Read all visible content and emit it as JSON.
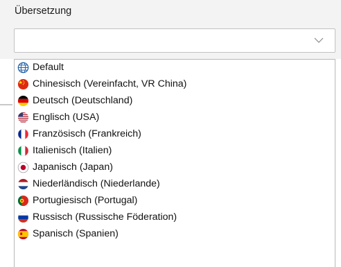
{
  "translation": {
    "label": "Übersetzung",
    "selected_value": "",
    "chevron_icon": "chevron-down-icon",
    "options": [
      {
        "label": "Default",
        "icon": "globe-icon"
      },
      {
        "label": "Chinesisch (Vereinfacht, VR China)",
        "icon": "flag-china-icon"
      },
      {
        "label": "Deutsch (Deutschland)",
        "icon": "flag-germany-icon"
      },
      {
        "label": "Englisch (USA)",
        "icon": "flag-usa-icon"
      },
      {
        "label": "Französisch (Frankreich)",
        "icon": "flag-france-icon"
      },
      {
        "label": "Italienisch (Italien)",
        "icon": "flag-italy-icon"
      },
      {
        "label": "Japanisch (Japan)",
        "icon": "flag-japan-icon"
      },
      {
        "label": "Niederländisch (Niederlande)",
        "icon": "flag-netherlands-icon"
      },
      {
        "label": "Portugiesisch (Portugal)",
        "icon": "flag-portugal-icon"
      },
      {
        "label": "Russisch (Russische Föderation)",
        "icon": "flag-russia-icon"
      },
      {
        "label": "Spanisch (Spanien)",
        "icon": "flag-spain-icon"
      }
    ]
  },
  "colors": {
    "background_band": "#f3f3f3",
    "border": "#c2c2c2",
    "globe": "#1f5fa8"
  }
}
